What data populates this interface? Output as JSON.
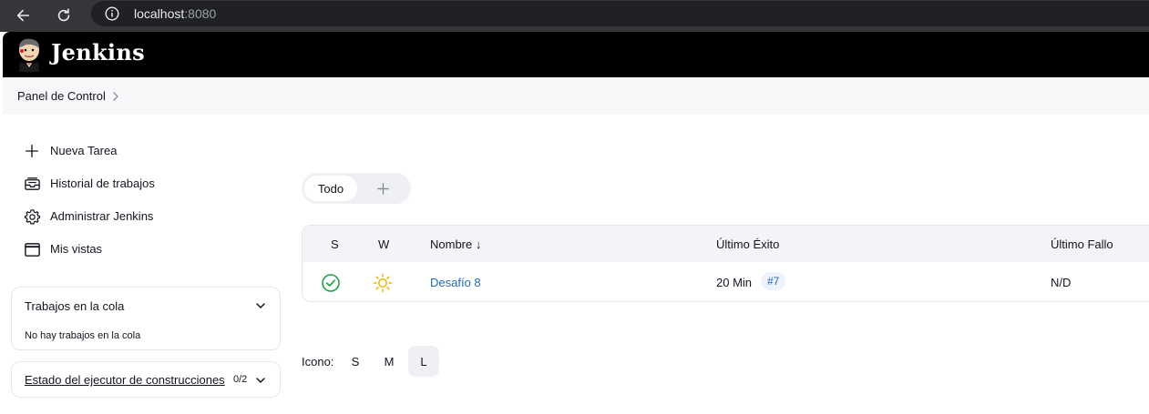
{
  "browser": {
    "url_host": "localhost",
    "url_port": ":8080"
  },
  "header": {
    "brand": "Jenkins"
  },
  "breadcrumb": {
    "items": [
      "Panel de Control"
    ]
  },
  "sidebar": {
    "tasks": [
      {
        "label": "Nueva Tarea",
        "icon": "plus-icon"
      },
      {
        "label": "Historial de trabajos",
        "icon": "inbox-history-icon"
      },
      {
        "label": "Administrar Jenkins",
        "icon": "gear-icon"
      },
      {
        "label": "Mis vistas",
        "icon": "window-icon"
      }
    ],
    "queue": {
      "title": "Trabajos en la cola",
      "empty_text": "No hay trabajos en la cola"
    },
    "executors": {
      "title": "Estado del ejecutor de construcciones",
      "count": "0/2"
    }
  },
  "views": {
    "tabs": [
      {
        "label": "Todo",
        "active": true
      }
    ],
    "add_icon": "plus-icon"
  },
  "jobs_table": {
    "columns": [
      "S",
      "W",
      "Nombre ↓",
      "Último Éxito",
      "Último Fallo"
    ],
    "rows": [
      {
        "status_icon": "success-check-icon",
        "status_color": "#1ea446",
        "weather_icon": "sunny-icon",
        "weather_color": "#f0b400",
        "name": "Desafío 8",
        "last_success": "20 Min",
        "last_success_build": "#7",
        "last_failure": "N/D"
      }
    ]
  },
  "icon_size": {
    "label": "Icono:",
    "options": [
      "S",
      "M",
      "L"
    ],
    "selected": "L"
  }
}
